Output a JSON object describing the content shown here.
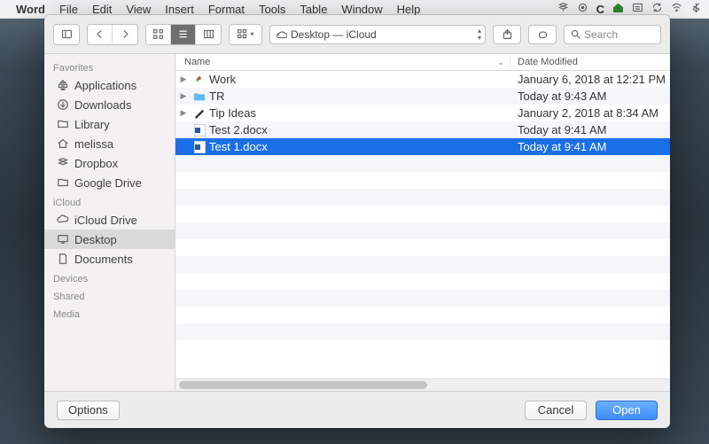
{
  "menubar": {
    "app": "Word",
    "items": [
      "File",
      "Edit",
      "View",
      "Insert",
      "Format",
      "Tools",
      "Table",
      "Window",
      "Help"
    ],
    "status_icons": [
      "dropbox-icon",
      "target-icon",
      "letter-c-icon",
      "home-icon",
      "recent-icon",
      "sync-icon",
      "wifi-icon",
      "bluetooth-icon"
    ]
  },
  "toolbar": {
    "path_label": "Desktop — iCloud",
    "search_placeholder": "Search"
  },
  "sidebar": {
    "sections": [
      {
        "heading": "Favorites",
        "items": [
          {
            "icon": "apps-icon",
            "label": "Applications"
          },
          {
            "icon": "download-icon",
            "label": "Downloads"
          },
          {
            "icon": "folder-icon",
            "label": "Library"
          },
          {
            "icon": "house-icon",
            "label": "melissa"
          },
          {
            "icon": "dropbox-icon",
            "label": "Dropbox"
          },
          {
            "icon": "folder-icon",
            "label": "Google Drive"
          }
        ]
      },
      {
        "heading": "iCloud",
        "items": [
          {
            "icon": "cloud-icon",
            "label": "iCloud Drive"
          },
          {
            "icon": "desktop-icon",
            "label": "Desktop",
            "selected": true
          },
          {
            "icon": "doc-icon",
            "label": "Documents"
          }
        ]
      },
      {
        "heading": "Devices",
        "items": []
      },
      {
        "heading": "Shared",
        "items": []
      },
      {
        "heading": "Media",
        "items": []
      }
    ]
  },
  "columns": {
    "name": "Name",
    "date": "Date Modified"
  },
  "files": [
    {
      "kind": "folder",
      "icon": "apple-folder",
      "name": "Work",
      "date": "January 6, 2018 at 12:21 PM",
      "expandable": true
    },
    {
      "kind": "folder",
      "icon": "blue-folder",
      "name": "TR",
      "date": "Today at 9:43 AM",
      "expandable": true
    },
    {
      "kind": "folder",
      "icon": "pen-folder",
      "name": "Tip Ideas",
      "date": "January 2, 2018 at 8:34 AM",
      "expandable": true
    },
    {
      "kind": "file",
      "icon": "word-doc",
      "name": "Test 2.docx",
      "date": "Today at 9:41 AM",
      "expandable": false
    },
    {
      "kind": "file",
      "icon": "word-doc",
      "name": "Test 1.docx",
      "date": "Today at 9:41 AM",
      "expandable": false,
      "selected": true
    }
  ],
  "footer": {
    "options": "Options",
    "cancel": "Cancel",
    "open": "Open"
  }
}
